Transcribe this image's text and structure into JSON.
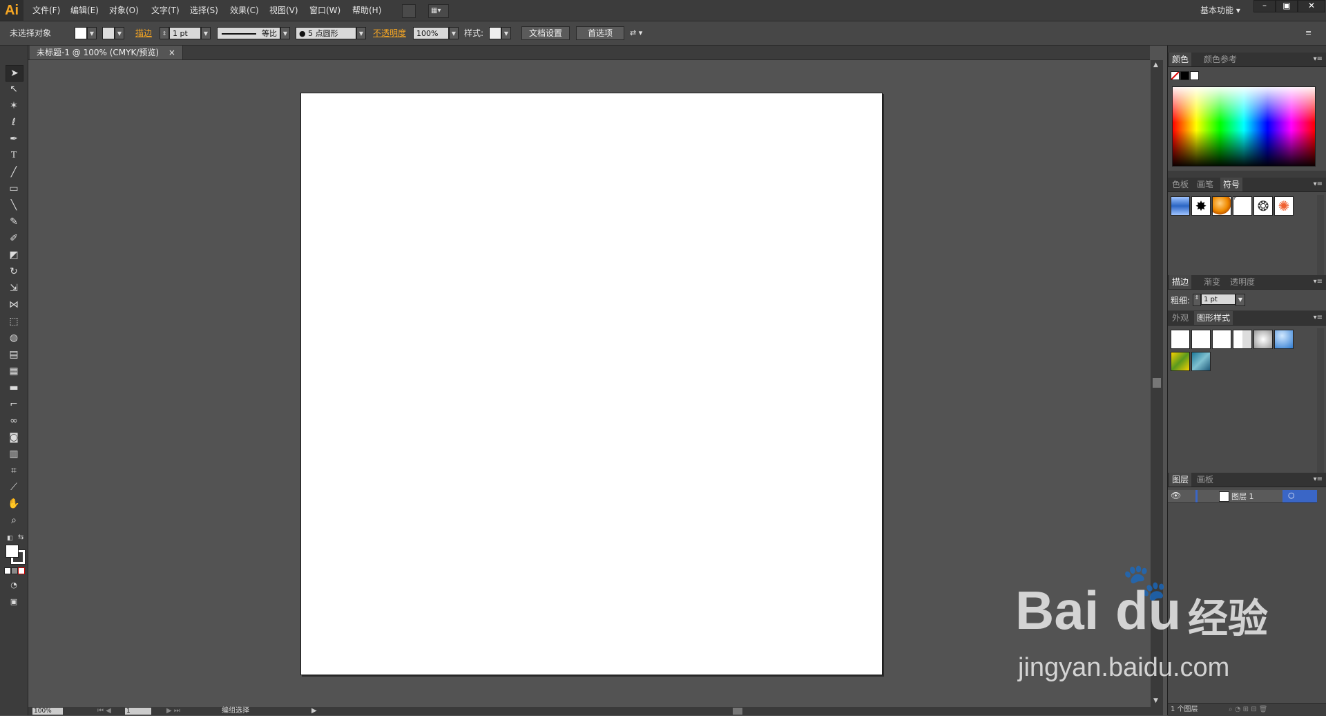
{
  "app": {
    "logo": "Ai"
  },
  "menu": [
    "文件(F)",
    "编辑(E)",
    "对象(O)",
    "文字(T)",
    "选择(S)",
    "效果(C)",
    "视图(V)",
    "窗口(W)",
    "帮助(H)"
  ],
  "workspace": "基本功能",
  "window_buttons": [
    "–",
    "▣",
    "✕"
  ],
  "control": {
    "selection": "未选择对象",
    "stroke_label": "描边",
    "stroke_weight": "1 pt",
    "stroke_profile": "等比",
    "brush": "● 5 点圆形",
    "opacity_label": "不透明度",
    "opacity": "100%",
    "style_label": "样式:",
    "doc_setup": "文档设置",
    "preferences": "首选项"
  },
  "document": {
    "tab": "未标题-1 @ 100% (CMYK/预览)",
    "close": "×"
  },
  "status": {
    "zoom": "100%",
    "page": "1",
    "tool": "编组选择"
  },
  "panels": {
    "color": {
      "tabs": [
        "颜色",
        "颜色参考"
      ]
    },
    "symbols": {
      "tabs": [
        "色板",
        "画笔",
        "符号"
      ],
      "active": "符号"
    },
    "stroke": {
      "tabs": [
        "描边",
        "渐变",
        "透明度"
      ],
      "weight_label": "粗细:",
      "weight": "1 pt"
    },
    "graphic_styles": {
      "tabs": [
        "外观",
        "图形样式"
      ],
      "active": "图形样式"
    },
    "layers": {
      "tabs": [
        "图层",
        "画板"
      ],
      "layer_name": "图层 1",
      "footer": "1 个图层"
    }
  },
  "watermark": {
    "brand": "Bai",
    "brand2": "du",
    "brand3": "经验",
    "url": "jingyan.baidu.com"
  },
  "colors": {
    "accent": "#f6a623",
    "ui_dark": "#3c3c3c",
    "canvas": "#535353",
    "artboard": "#ffffff",
    "layer_blue": "#3a66c6"
  }
}
